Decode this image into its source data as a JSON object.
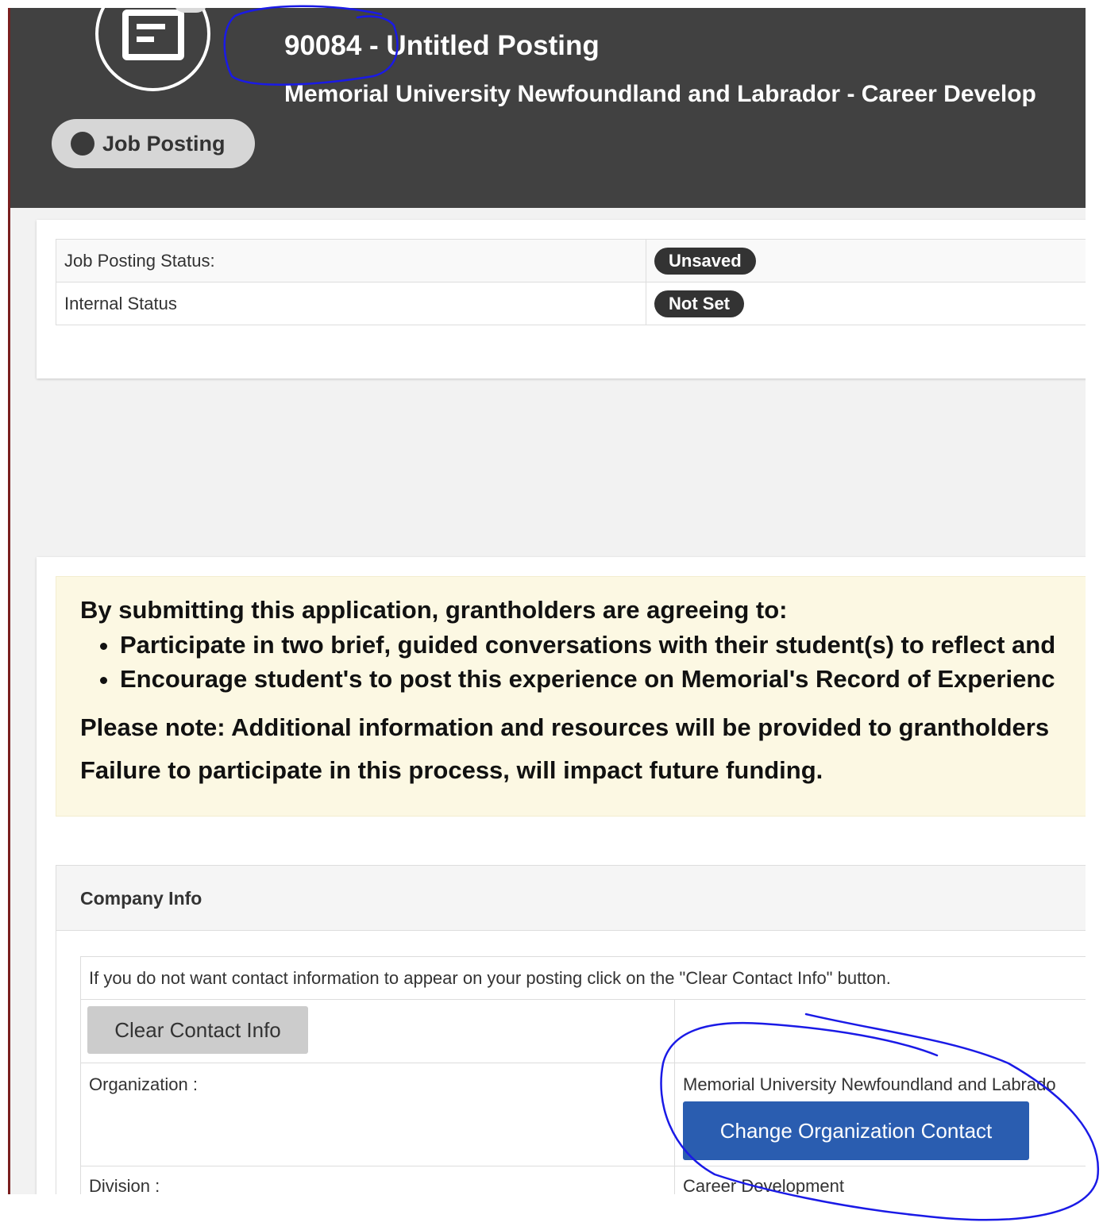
{
  "header": {
    "posting_title": "90084 - Untitled Posting",
    "organization": "Memorial University Newfoundland and Labrador - Career Develop",
    "type_label": "Job Posting",
    "logo_icon": "document-icon",
    "background_color": "#414141"
  },
  "status": {
    "rows": [
      {
        "label": "Job Posting Status:",
        "value": "Unsaved"
      },
      {
        "label": "Internal Status",
        "value": "Not Set"
      }
    ]
  },
  "notice": {
    "intro": "By submitting this application, grantholders are agreeing to:",
    "items": [
      "Participate in two brief, guided conversations with their student(s) to reflect and",
      "Encourage student's to post this experience on Memorial's Record of Experienc"
    ],
    "note": "Please note:  Additional information and resources will be provided to grantholders",
    "failure": "Failure to participate in this process, will impact future funding."
  },
  "company_info": {
    "heading": "Company Info",
    "instruction": "If you do not want contact information to appear on your posting click on the \"Clear Contact Info\" button.",
    "clear_button": "Clear Contact Info",
    "organization_label": "Organization :",
    "organization_value": "Memorial University Newfoundland and Labrado",
    "change_button": "Change Organization Contact",
    "division_label": "Division :",
    "division_value": "Career Development",
    "button_color": "#2a5db0"
  },
  "annotation_color": "#1a1ae6"
}
